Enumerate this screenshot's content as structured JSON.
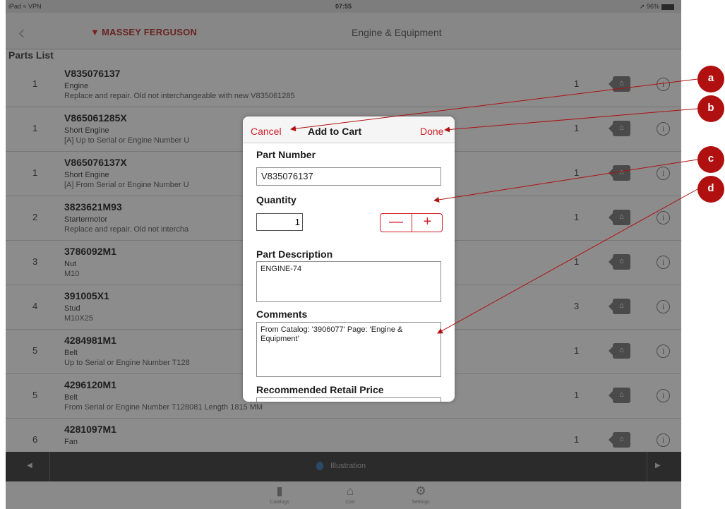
{
  "status_bar": {
    "device": "iPad",
    "wifi": "wifi-icon",
    "vpn": "VPN",
    "time": "07:55",
    "battery": "96%"
  },
  "nav": {
    "brand": "MASSEY FERGUSON",
    "title": "Engine & Equipment"
  },
  "list_header": "Parts List",
  "rows": [
    {
      "index": "1",
      "part_number": "V835076137",
      "description": "Engine",
      "note": "Replace and repair. Old not interchangeable with new V835061285",
      "qty": "1"
    },
    {
      "index": "1",
      "part_number": "V865061285X",
      "description": "Short Engine",
      "note": "[A] Up to Serial or Engine Number U",
      "qty": "1"
    },
    {
      "index": "1",
      "part_number": "V865076137X",
      "description": "Short Engine",
      "note": "[A] From Serial or Engine Number U",
      "qty": "1"
    },
    {
      "index": "2",
      "part_number": "3823621M93",
      "description": "Startermotor",
      "note": "Replace and repair. Old not intercha",
      "qty": "1"
    },
    {
      "index": "3",
      "part_number": "3786092M1",
      "description": "Nut",
      "note": "M10",
      "qty": "1"
    },
    {
      "index": "4",
      "part_number": "391005X1",
      "description": "Stud",
      "note": "M10X25",
      "qty": "3"
    },
    {
      "index": "5",
      "part_number": "4284981M1",
      "description": "Belt",
      "note": "Up to Serial or Engine Number T128",
      "qty": "1"
    },
    {
      "index": "5",
      "part_number": "4296120M1",
      "description": "Belt",
      "note": "From Serial or Engine Number T128081 Length 1815 MM",
      "qty": "1"
    },
    {
      "index": "6",
      "part_number": "4281097M1",
      "description": "Fan",
      "note": "",
      "qty": "1"
    }
  ],
  "illustration_bar": {
    "label": "Illustration"
  },
  "tabs": [
    {
      "label": "Catalogs",
      "icon": "book-icon"
    },
    {
      "label": "Cart",
      "icon": "cart-icon"
    },
    {
      "label": "Settings",
      "icon": "gear-icon"
    }
  ],
  "modal": {
    "cancel": "Cancel",
    "title": "Add to Cart",
    "done": "Done",
    "part_number_label": "Part Number",
    "part_number_value": "V835076137",
    "quantity_label": "Quantity",
    "quantity_value": "1",
    "minus": "—",
    "plus": "+",
    "description_label": "Part Description",
    "description_value": "ENGINE-74",
    "comments_label": "Comments",
    "comments_value": "From Catalog: '3906077' Page: 'Engine & Equipment'",
    "price_label": "Recommended Retail Price"
  },
  "callouts": [
    "a",
    "b",
    "c",
    "d"
  ],
  "colors": {
    "accent": "#d0202a",
    "callout": "#b01010",
    "overlay": "#8c8c8c",
    "tabbar_dark": "#2b2b2b"
  }
}
